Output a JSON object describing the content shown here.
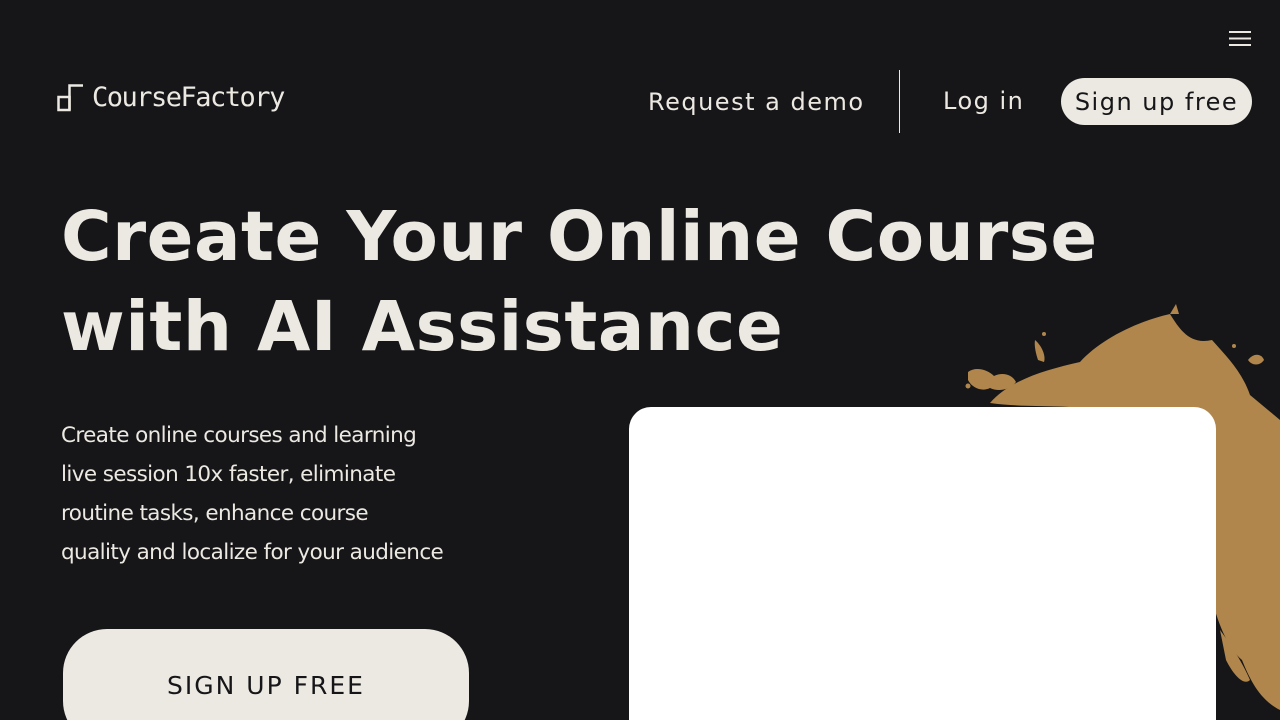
{
  "header": {
    "logo_text": "CourseFactory",
    "menu_icon": "hamburger-menu-icon",
    "nav": {
      "request_demo": "Request a demo",
      "log_in": "Log in",
      "sign_up": "Sign up free"
    }
  },
  "hero": {
    "title_lines": [
      "Create Your Online Course",
      "with AI Assistance"
    ],
    "description_lines": [
      "Create online courses and learning",
      "live session 10x faster, eliminate",
      "routine tasks, enhance course",
      "quality and localize for your audience"
    ],
    "cta_label": "SIGN UP FREE"
  },
  "colors": {
    "background": "#161618",
    "text": "#ece8e2",
    "button_fill": "#ece8e2",
    "splash": "#b0864c",
    "card": "#ffffff"
  }
}
